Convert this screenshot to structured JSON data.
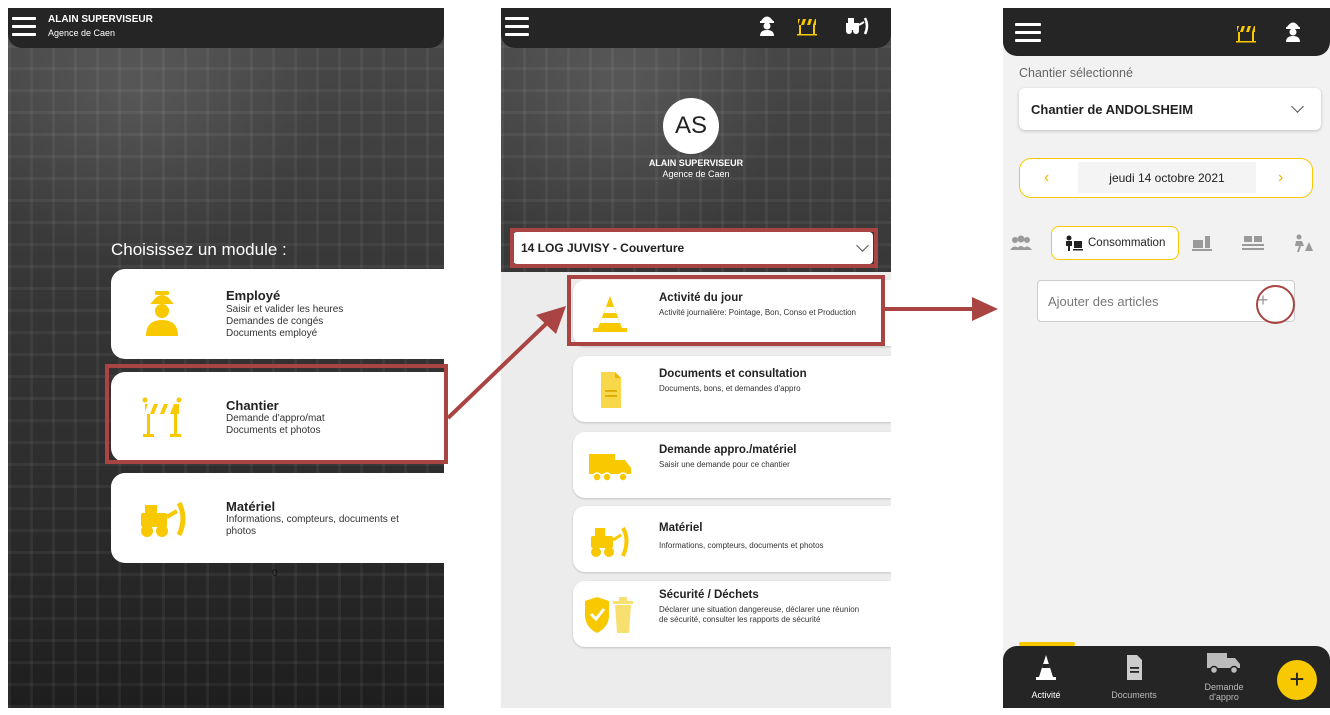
{
  "colors": {
    "accent": "#f8c800",
    "highlight": "#a94442",
    "topbar": "#252525"
  },
  "screen1": {
    "user_name": "ALAIN SUPERVISEUR",
    "agency": "Agence de Caen",
    "choose_title": "Choisissez un module :",
    "modules": [
      {
        "icon": "worker-icon",
        "title": "Employé",
        "desc": [
          "Saisir et valider les heures",
          "Demandes de congés",
          "Documents employé"
        ]
      },
      {
        "icon": "barrier-icon",
        "title": "Chantier",
        "desc": [
          "Demande d'appro/mat",
          "Documents et photos"
        ]
      },
      {
        "icon": "bulldozer-icon",
        "title": "Matériel",
        "desc": [
          "Informations, compteurs, documents et",
          "photos"
        ]
      }
    ],
    "stray_text": "0"
  },
  "screen2": {
    "avatar_initials": "AS",
    "user_name": "ALAIN SUPERVISEUR",
    "agency": "Agence de Caen",
    "chantier_selected": "14 LOG JUVISY - Couverture",
    "cards": [
      {
        "icon": "cone-icon",
        "title": "Activité du jour",
        "desc": "Activité journalière: Pointage, Bon, Conso et Production"
      },
      {
        "icon": "document-icon",
        "title": "Documents et consultation",
        "desc": "Documents, bons, et demandes d'appro"
      },
      {
        "icon": "truck-icon",
        "title": "Demande appro./matériel",
        "desc": "Saisir une demande pour ce chantier"
      },
      {
        "icon": "bulldozer-icon",
        "title": "Matériel",
        "desc": "Informations, compteurs, documents et photos"
      },
      {
        "icon": "safety-icon",
        "title": "Sécurité / Déchets",
        "desc": "Déclarer une situation dangereuse, déclarer une réunion de sécurité, consulter les rapports de sécurité"
      }
    ]
  },
  "screen3": {
    "selected_label": "Chantier sélectionné",
    "chantier": "Chantier de ANDOLSHEIM",
    "date": "jeudi 14 octobre 2021",
    "prev_arrow": "‹",
    "next_arrow": "›",
    "active_tab": "Consommation",
    "add_placeholder": "Ajouter des articles",
    "bottom_nav": [
      {
        "icon": "cone-icon",
        "label": "Activité"
      },
      {
        "icon": "document-icon",
        "label": "Documents"
      },
      {
        "icon": "truck-icon",
        "label": "Demande d'appro"
      }
    ],
    "fab_label": "+"
  }
}
